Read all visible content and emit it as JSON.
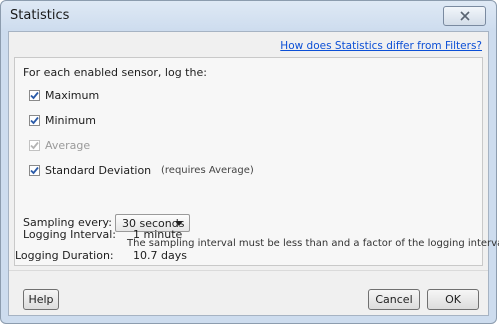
{
  "window": {
    "title": "Statistics"
  },
  "header": {
    "help_link": "How does Statistics differ from Filters?"
  },
  "options": {
    "intro": "For each enabled sensor, log the:",
    "maximum": {
      "label": "Maximum",
      "checked": true,
      "enabled": true
    },
    "minimum": {
      "label": "Minimum",
      "checked": true,
      "enabled": true
    },
    "average": {
      "label": "Average",
      "checked": true,
      "enabled": false
    },
    "std_dev": {
      "label": "Standard Deviation",
      "note": "(requires Average)",
      "checked": true,
      "enabled": true
    }
  },
  "sampling": {
    "label": "Sampling every:",
    "value": "30 seconds",
    "hint": "The sampling interval must be less than and a factor of the logging interval."
  },
  "logging": {
    "interval_label": "Logging Interval:",
    "interval_value": "1 minute",
    "duration_label": "Logging Duration:",
    "duration_value": "10.7 days"
  },
  "buttons": {
    "help": "Help",
    "cancel": "Cancel",
    "ok": "OK"
  },
  "colors": {
    "link": "#0b4fd6",
    "check": "#2a5aa8",
    "check_disabled": "#b4b4b4"
  },
  "icons": {
    "close": "close-x-icon",
    "dropdown": "chevron-down-icon",
    "check": "checkmark-icon"
  }
}
